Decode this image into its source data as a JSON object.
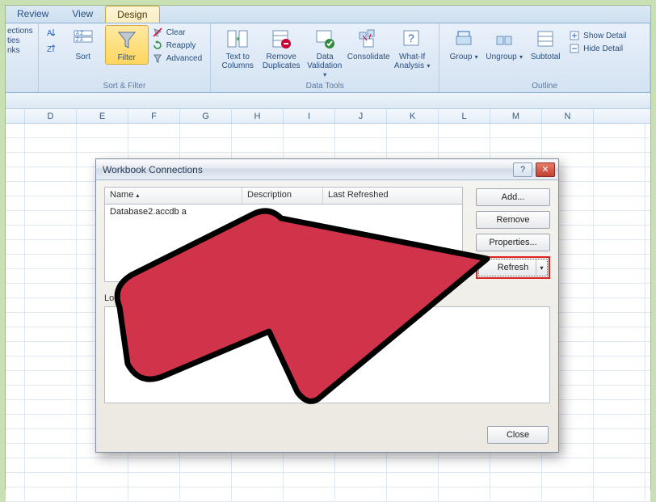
{
  "tabs": {
    "review": "Review",
    "view": "View",
    "design": "Design"
  },
  "ribbon": {
    "connections": {
      "ections": "ections",
      "ties": "ties",
      "nks": "nks"
    },
    "sort_filter": {
      "sort": "Sort",
      "filter": "Filter",
      "clear": "Clear",
      "reapply": "Reapply",
      "advanced": "Advanced",
      "group": "Sort & Filter",
      "az_icon": "A→Z",
      "za_icon": "Z→A"
    },
    "data_tools": {
      "text_to_columns": "Text to\nColumns",
      "remove_duplicates": "Remove\nDuplicates",
      "data_validation": "Data\nValidation",
      "consolidate": "Consolidate",
      "whatif": "What-If\nAnalysis",
      "group": "Data Tools"
    },
    "outline": {
      "group_btn": "Group",
      "ungroup": "Ungroup",
      "subtotal": "Subtotal",
      "show_detail": "Show Detail",
      "hide_detail": "Hide Detail",
      "group": "Outline"
    }
  },
  "columns": [
    "D",
    "E",
    "F",
    "G",
    "H",
    "I",
    "J",
    "K",
    "L",
    "M",
    "N"
  ],
  "dialog": {
    "title": "Workbook Connections",
    "col_name": "Name",
    "col_desc": "Description",
    "col_last": "Last Refreshed",
    "row1": "Database2.accdb a",
    "locations_label": "Locations where",
    "add": "Add...",
    "remove": "Remove",
    "properties": "Properties...",
    "refresh": "Refresh",
    "close": "Close",
    "help_icon": "?",
    "x_icon": "✕"
  }
}
